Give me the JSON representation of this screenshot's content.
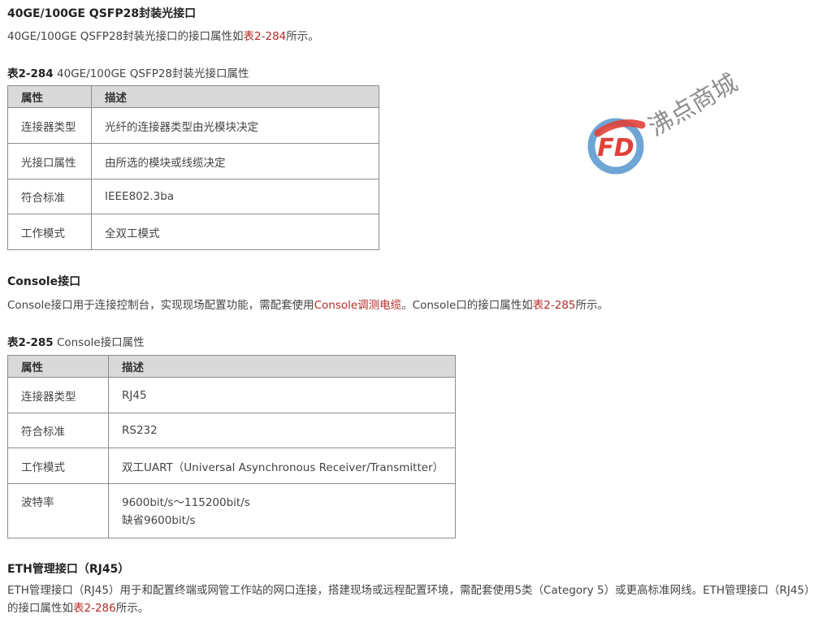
{
  "section1": {
    "heading": "40GE/100GE QSFP28封装光接口",
    "intro_text": "40GE/100GE QSFP28封装光接口的接口属性如",
    "intro_link": "表2-284",
    "intro_tail": "所示。",
    "table_caption_label": "表2-284",
    "table_caption_text": " 40GE/100GE QSFP28封装光接口属性",
    "table": {
      "headers": [
        "属性",
        "描述"
      ],
      "rows": [
        [
          "连接器类型",
          "光纤的连接器类型由光模块决定"
        ],
        [
          "光接口属性",
          "由所选的模块或线缆决定"
        ],
        [
          "符合标准",
          "IEEE802.3ba"
        ],
        [
          "工作模式",
          "全双工模式"
        ]
      ]
    }
  },
  "section2": {
    "heading": "Console接口",
    "intro_text": "Console接口用于连接控制台，实现现场配置功能，需配套使用",
    "intro_link1": "Console调测电缆",
    "intro_mid": "。Console口的接口属性如",
    "intro_link2": "表2-285",
    "intro_tail": "所示。",
    "table_caption_label": "表2-285",
    "table_caption_text": " Console接口属性",
    "table": {
      "headers": [
        "属性",
        "描述"
      ],
      "rows": [
        [
          "连接器类型",
          "RJ45"
        ],
        [
          "符合标准",
          "RS232"
        ],
        [
          "工作模式",
          "双工UART（Universal Asynchronous Receiver/Transmitter）"
        ],
        [
          "波特率",
          "9600bit/s～115200bit/s",
          "缺省9600bit/s"
        ]
      ]
    }
  },
  "section3": {
    "heading": "ETH管理接口（RJ45）",
    "intro_text": "ETH管理接口（RJ45）用于和配置终端或网管工作站的网口连接，搭建现场或远程配置环境，需配套使用5类（Category 5）或更高标准网线。ETH管理接口（RJ45）的接口属性如",
    "intro_link": "表2-286",
    "intro_tail": "所示。"
  },
  "watermark": {
    "logo_letters": "FD",
    "brand_text": "沸点商城",
    "colors": {
      "red": "#e0413a",
      "blue": "#3d87c7",
      "brand_text": "#8d8d8d"
    }
  }
}
